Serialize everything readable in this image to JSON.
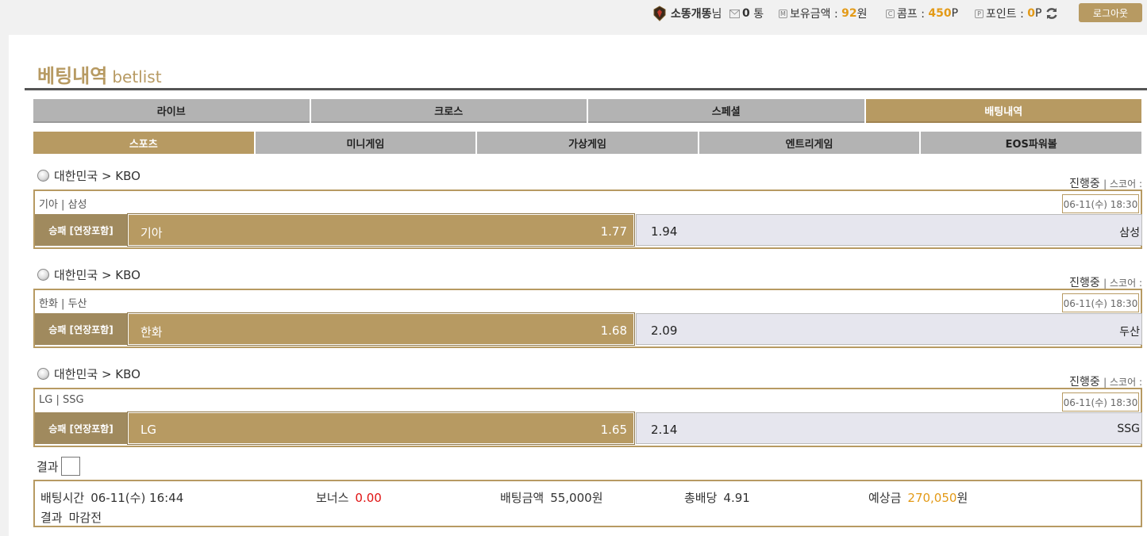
{
  "header": {
    "username": "소똥개똥",
    "honorific": "님",
    "messages_count": "0",
    "messages_unit": "통",
    "balance_label": "보유금액 :",
    "balance_value": "92",
    "balance_unit": "원",
    "comp_label": "콤프 :",
    "comp_value": "450",
    "comp_unit": "P",
    "point_label": "포인트 :",
    "point_value": "0",
    "point_unit": "P",
    "logout_label": "로그아웃"
  },
  "page": {
    "title": "베팅내역",
    "subtitle": "betlist"
  },
  "tabs_main": [
    {
      "label": "라이브",
      "active": false
    },
    {
      "label": "크로스",
      "active": false
    },
    {
      "label": "스페셜",
      "active": false
    },
    {
      "label": "배팅내역",
      "active": true
    }
  ],
  "tabs_sub": [
    {
      "label": "스포츠",
      "active": true
    },
    {
      "label": "미니게임",
      "active": false
    },
    {
      "label": "가상게임",
      "active": false
    },
    {
      "label": "엔트리게임",
      "active": false
    },
    {
      "label": "EOS파워볼",
      "active": false
    }
  ],
  "matches": [
    {
      "league": "대한민국 > KBO",
      "status": "진행중",
      "score_label": "| 스코어 :",
      "teams": "기아 | 삼성",
      "time": "06-11(수) 18:30",
      "market": "승패 [연장포함]",
      "pick_team": "기아",
      "pick_odds": "1.77",
      "other_odds": "1.94",
      "other_team": "삼성"
    },
    {
      "league": "대한민국 > KBO",
      "status": "진행중",
      "score_label": "| 스코어 :",
      "teams": "한화 | 두산",
      "time": "06-11(수) 18:30",
      "market": "승패 [연장포함]",
      "pick_team": "한화",
      "pick_odds": "1.68",
      "other_odds": "2.09",
      "other_team": "두산"
    },
    {
      "league": "대한민국 > KBO",
      "status": "진행중",
      "score_label": "| 스코어 :",
      "teams": "LG | SSG",
      "time": "06-11(수) 18:30",
      "market": "승패 [연장포함]",
      "pick_team": "LG",
      "pick_odds": "1.65",
      "other_odds": "2.14",
      "other_team": "SSG"
    }
  ],
  "result_checkbox_label": "결과",
  "summary": {
    "bet_time_label": "배팅시간",
    "bet_time": "06-11(수) 16:44",
    "bonus_label": "보너스",
    "bonus": "0.00",
    "amount_label": "배팅금액",
    "amount": "55,000원",
    "total_odds_label": "총배당",
    "total_odds": "4.91",
    "expected_label": "예상금",
    "expected": "270,050",
    "expected_unit": "원",
    "result_label": "결과",
    "result": "마감전"
  },
  "colors": {
    "gold": "#b79a62",
    "accent_orange": "#e39a17",
    "bonus_red": "#e01111",
    "tab_gray": "#b3b3b3"
  }
}
